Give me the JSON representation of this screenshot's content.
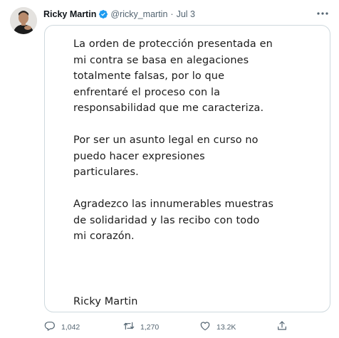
{
  "tweet": {
    "author_name": "Ricky Martin",
    "handle": "@ricky_martin",
    "separator": "·",
    "date": "Jul 3",
    "image_text": {
      "paragraph_1": "La orden de protección presentada en\nmi contra se basa en alegaciones\ntotalmente falsas, por lo que\nenfrentaré el proceso con la\nresponsabilidad que me caracteriza.",
      "paragraph_2": "Por ser un asunto legal en curso no\npuedo hacer expresiones\nparticulares.",
      "paragraph_3": "Agradezco las innumerables muestras\nde solidaridad y las recibo con todo\nmi corazón.",
      "signature": "Ricky Martin"
    },
    "stats": {
      "replies": "1,042",
      "retweets": "1,270",
      "likes": "13.2K"
    }
  },
  "icons": {
    "verified": "verified-badge-icon",
    "more": "more-options-icon",
    "reply": "reply-icon",
    "retweet": "retweet-icon",
    "like": "heart-icon",
    "share": "share-icon"
  },
  "colors": {
    "verified_blue": "#1d9bf0",
    "secondary_text": "#536471",
    "card_border": "#cfd9de"
  }
}
